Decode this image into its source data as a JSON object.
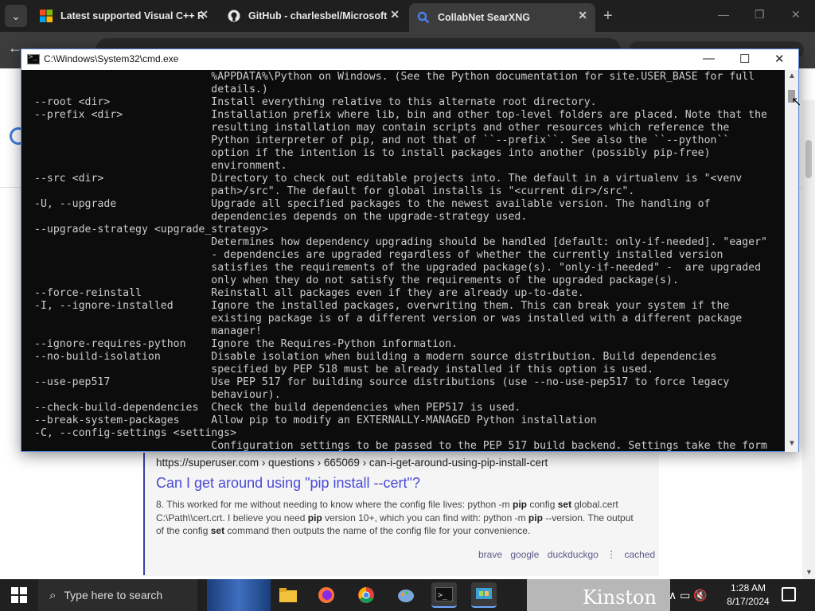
{
  "browser": {
    "tabs": [
      {
        "label": "Latest supported Visual C++ R",
        "icon": "windows-logo-icon"
      },
      {
        "label": "GitHub - charlesbel/Microsoft",
        "icon": "github-icon"
      },
      {
        "label": "CollabNet SearXNG",
        "icon": "search-icon",
        "active": true
      }
    ],
    "new_tab": "+",
    "tab_close": "✕"
  },
  "cmd": {
    "title": "C:\\Windows\\System32\\cmd.exe",
    "lines": [
      "                            %APPDATA%\\Python on Windows. (See the Python documentation for site.USER_BASE for full",
      "                            details.)",
      "--root <dir>                Install everything relative to this alternate root directory.",
      "--prefix <dir>              Installation prefix where lib, bin and other top-level folders are placed. Note that the",
      "                            resulting installation may contain scripts and other resources which reference the",
      "                            Python interpreter of pip, and not that of ``--prefix``. See also the ``--python``",
      "                            option if the intention is to install packages into another (possibly pip-free)",
      "                            environment.",
      "--src <dir>                 Directory to check out editable projects into. The default in a virtualenv is \"<venv",
      "                            path>/src\". The default for global installs is \"<current dir>/src\".",
      "-U, --upgrade               Upgrade all specified packages to the newest available version. The handling of",
      "                            dependencies depends on the upgrade-strategy used.",
      "--upgrade-strategy <upgrade_strategy>",
      "                            Determines how dependency upgrading should be handled [default: only-if-needed]. \"eager\"",
      "                            - dependencies are upgraded regardless of whether the currently installed version",
      "                            satisfies the requirements of the upgraded package(s). \"only-if-needed\" -  are upgraded",
      "                            only when they do not satisfy the requirements of the upgraded package(s).",
      "--force-reinstall           Reinstall all packages even if they are already up-to-date.",
      "-I, --ignore-installed      Ignore the installed packages, overwriting them. This can break your system if the",
      "                            existing package is of a different version or was installed with a different package",
      "                            manager!",
      "--ignore-requires-python    Ignore the Requires-Python information.",
      "--no-build-isolation        Disable isolation when building a modern source distribution. Build dependencies",
      "                            specified by PEP 518 must be already installed if this option is used.",
      "--use-pep517                Use PEP 517 for building source distributions (use --no-use-pep517 to force legacy",
      "                            behaviour).",
      "--check-build-dependencies  Check the build dependencies when PEP517 is used.",
      "--break-system-packages     Allow pip to modify an EXTERNALLY-MANAGED Python installation",
      "-C, --config-settings <settings>",
      "                            Configuration settings to be passed to the PEP 517 build backend. Settings take the form"
    ]
  },
  "result": {
    "url_host": "https://superuser.com",
    "url_path": " › questions › 665069 › can-i-get-around-using-pip-install-cert",
    "title": "Can I get around using \"pip install --cert\"?",
    "snippet_parts": [
      {
        "t": "8. This worked for me without needing to know where the config file lives: python -m "
      },
      {
        "t": "pip",
        "b": true
      },
      {
        "t": " config "
      },
      {
        "t": "set",
        "b": true
      },
      {
        "t": " global.cert C:\\Path\\\\cert.crt. I believe you need "
      },
      {
        "t": "pip",
        "b": true
      },
      {
        "t": " version 10+, which you can find with: python -m "
      },
      {
        "t": "pip",
        "b": true
      },
      {
        "t": " --version. The output of the config "
      },
      {
        "t": "set",
        "b": true
      },
      {
        "t": " command then outputs the name of the config file for your convenience."
      }
    ],
    "links": [
      "brave",
      "google",
      "duckduckgo",
      "⋮",
      "cached"
    ]
  },
  "taskbar": {
    "search_placeholder": "Type here to search",
    "widget_text": "Kinston",
    "time": "1:28 AM",
    "date": "8/17/2024"
  },
  "colors": {
    "link_title": "#4a4ad8",
    "console_bg": "#0c0c0c",
    "console_fg": "#cccccc"
  }
}
